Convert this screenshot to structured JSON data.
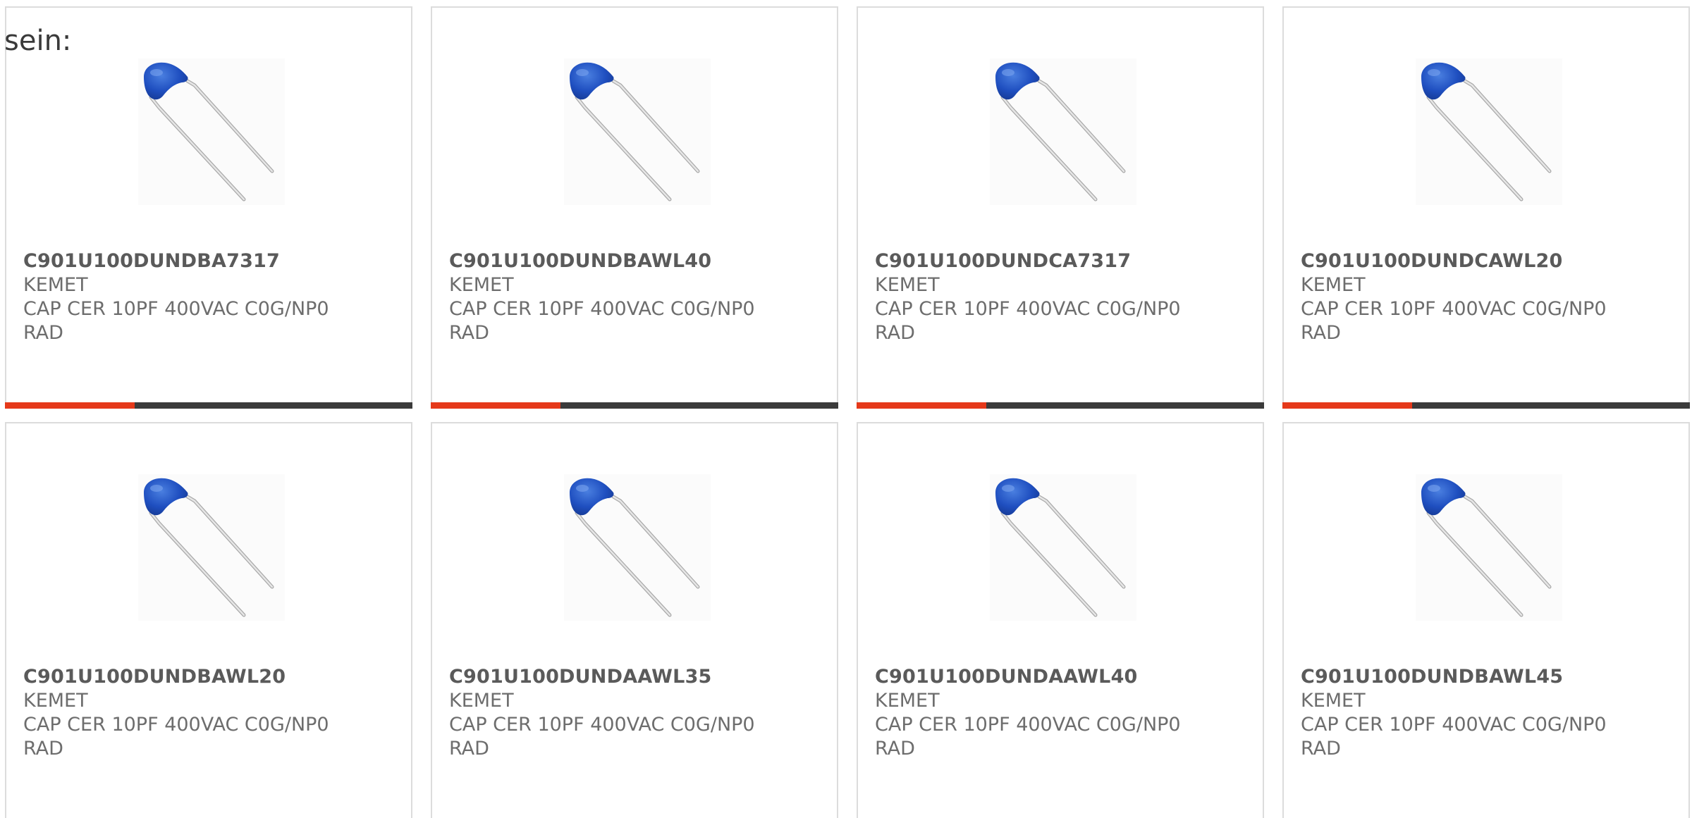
{
  "intro_text": "sein:",
  "accent_color": "#e5391a",
  "products": [
    {
      "part": "C901U100DUNDBA7317",
      "manufacturer": "KEMET",
      "description_line1": "CAP CER 10PF 400VAC C0G/NP0",
      "description_line2": "RAD",
      "image_icon": "capacitor-image"
    },
    {
      "part": "C901U100DUNDBAWL40",
      "manufacturer": "KEMET",
      "description_line1": "CAP CER 10PF 400VAC C0G/NP0",
      "description_line2": "RAD",
      "image_icon": "capacitor-image"
    },
    {
      "part": "C901U100DUNDCA7317",
      "manufacturer": "KEMET",
      "description_line1": "CAP CER 10PF 400VAC C0G/NP0",
      "description_line2": "RAD",
      "image_icon": "capacitor-image"
    },
    {
      "part": "C901U100DUNDCAWL20",
      "manufacturer": "KEMET",
      "description_line1": "CAP CER 10PF 400VAC C0G/NP0",
      "description_line2": "RAD",
      "image_icon": "capacitor-image"
    },
    {
      "part": "C901U100DUNDBAWL20",
      "manufacturer": "KEMET",
      "description_line1": "CAP CER 10PF 400VAC C0G/NP0",
      "description_line2": "RAD",
      "image_icon": "capacitor-image"
    },
    {
      "part": "C901U100DUNDAAWL35",
      "manufacturer": "KEMET",
      "description_line1": "CAP CER 10PF 400VAC C0G/NP0",
      "description_line2": "RAD",
      "image_icon": "capacitor-image"
    },
    {
      "part": "C901U100DUNDAAWL40",
      "manufacturer": "KEMET",
      "description_line1": "CAP CER 10PF 400VAC C0G/NP0",
      "description_line2": "RAD",
      "image_icon": "capacitor-image"
    },
    {
      "part": "C901U100DUNDBAWL45",
      "manufacturer": "KEMET",
      "description_line1": "CAP CER 10PF 400VAC C0G/NP0",
      "description_line2": "RAD",
      "image_icon": "capacitor-image"
    }
  ]
}
